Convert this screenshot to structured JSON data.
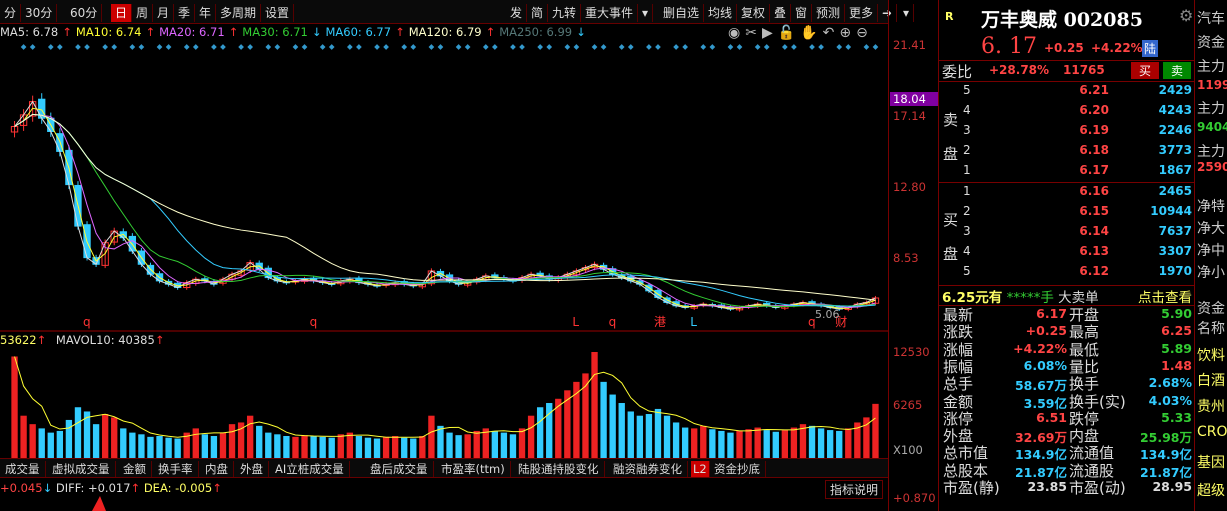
{
  "toolbar": {
    "left": [
      "分",
      "30分",
      "60分",
      "日",
      "周",
      "月",
      "季",
      "年",
      "多周期",
      "设置"
    ],
    "active": "日",
    "right": [
      "发",
      "简",
      "九转",
      "重大事件",
      "▾",
      "删自选",
      "均线",
      "复权",
      "叠",
      "窗",
      "预测",
      "更多",
      "➜",
      "▾"
    ]
  },
  "ma_legend": [
    {
      "label": "MA5: 6.78",
      "color": "#ddd",
      "dir": "up"
    },
    {
      "label": "MA10: 6.74",
      "color": "#ff3",
      "dir": "up"
    },
    {
      "label": "MA20: 6.71",
      "color": "#d6f",
      "dir": "up"
    },
    {
      "label": "MA30: 6.71",
      "color": "#3c3",
      "dir": "down"
    },
    {
      "label": "MA60: 6.77",
      "color": "#3cf",
      "dir": "up"
    },
    {
      "label": "MA120: 6.79",
      "color": "#ffc",
      "dir": "up"
    },
    {
      "label": "MA250: 6.99",
      "color": "#577",
      "dir": "down"
    }
  ],
  "chart_tools": [
    "eye-icon",
    "scissors-icon",
    "play-icon",
    "lock-icon",
    "hand-icon",
    "undo-icon",
    "zoom-in-icon",
    "zoom-out-icon"
  ],
  "price_axis": {
    "labels": [
      "21.41",
      "17.14",
      "12.80",
      "8.53"
    ],
    "highlight": "18.04"
  },
  "volume_axis": {
    "labels": [
      "12530",
      "6265",
      "X100"
    ]
  },
  "macd_axis": {
    "label": "+0.870"
  },
  "chart_data": {
    "type": "candlestick",
    "close": [
      16.5,
      17.2,
      18.0,
      17.0,
      16.2,
      15.0,
      13.0,
      10.5,
      8.6,
      8.2,
      9.5,
      10.2,
      9.8,
      9.0,
      8.2,
      7.6,
      7.2,
      7.0,
      6.8,
      7.1,
      7.3,
      7.2,
      7.0,
      7.3,
      7.6,
      7.8,
      8.3,
      7.9,
      7.4,
      7.2,
      7.1,
      7.2,
      7.3,
      7.2,
      7.1,
      7.0,
      7.2,
      7.3,
      7.1,
      7.0,
      6.9,
      7.0,
      7.1,
      7.0,
      6.9,
      7.0,
      7.8,
      7.5,
      7.2,
      7.0,
      7.1,
      7.3,
      7.5,
      7.4,
      7.3,
      7.2,
      7.4,
      7.6,
      7.5,
      7.3,
      7.4,
      7.6,
      7.8,
      8.0,
      8.2,
      7.9,
      7.6,
      7.4,
      7.2,
      7.0,
      6.6,
      6.2,
      5.9,
      5.7,
      5.6,
      5.7,
      5.8,
      5.7,
      5.6,
      5.5,
      5.6,
      5.7,
      5.8,
      5.7,
      5.6,
      5.7,
      5.8,
      5.9,
      5.8,
      5.7,
      5.6,
      5.5,
      5.6,
      5.8,
      5.9,
      6.17
    ],
    "volume": [
      12000,
      5000,
      4000,
      3500,
      3000,
      3200,
      4500,
      6000,
      5500,
      4000,
      5200,
      4800,
      3500,
      3000,
      2800,
      2500,
      2600,
      2400,
      2300,
      3000,
      3500,
      2800,
      2600,
      3000,
      4000,
      4200,
      5000,
      3800,
      3000,
      2800,
      2600,
      2500,
      2700,
      2600,
      2500,
      2400,
      2800,
      3000,
      2600,
      2400,
      2300,
      2500,
      2600,
      2400,
      2300,
      2600,
      5000,
      3800,
      3000,
      2700,
      2800,
      3200,
      3500,
      3200,
      3000,
      2800,
      3500,
      5000,
      6000,
      6500,
      7000,
      8000,
      9000,
      10000,
      12530,
      9000,
      7500,
      6500,
      5500,
      5000,
      5200,
      5800,
      5000,
      4200,
      3600,
      3500,
      3800,
      3400,
      3200,
      3000,
      3200,
      3400,
      3600,
      3300,
      3100,
      3300,
      3600,
      4000,
      3800,
      3500,
      3300,
      3200,
      3500,
      4200,
      4800,
      6400
    ],
    "markers": [
      {
        "text": "q",
        "idx": 8
      },
      {
        "text": "q",
        "idx": 33
      },
      {
        "text": "L",
        "idx": 62
      },
      {
        "text": "q",
        "idx": 66
      },
      {
        "text": "港",
        "idx": 71
      },
      {
        "text": "L",
        "idx": 75
      },
      {
        "text": "q",
        "idx": 88
      },
      {
        "text": "财",
        "idx": 91
      }
    ],
    "low_label": "5.06",
    "price_range": [
      4.5,
      21.41
    ],
    "volume_max": 12530
  },
  "vol_legend": {
    "vol": "53622",
    "mavol": "MAVOL10: 40385"
  },
  "bottom_tabs": [
    "成交量",
    "虚拟成交量",
    "金额",
    "换手率",
    "内盘",
    "外盘",
    "AI立桩成交量",
    "盘后成交量",
    "市盈率(ttm)",
    "陆股通持股变化",
    "融资融券变化",
    "资金抄底"
  ],
  "l2_badge": "L2",
  "macd": {
    "macd": "+0.045",
    "diff": "DIFF: +0.017",
    "dea": "DEA: -0.005",
    "explain": "指标说明"
  },
  "quote": {
    "r": "R",
    "name": "万丰奥威 002085",
    "price": "6. 17",
    "chg": "+0.25",
    "pct": "+4.22%",
    "lu": "陆",
    "weibi_label": "委比",
    "weibi": "+28.78%",
    "weicha": "11765",
    "buy": "买",
    "sell": "卖",
    "sell_label": "卖盘",
    "buy_label": "买盘",
    "asks": [
      [
        "5",
        "6.21",
        "2429"
      ],
      [
        "4",
        "6.20",
        "4243"
      ],
      [
        "3",
        "6.19",
        "2246"
      ],
      [
        "2",
        "6.18",
        "3773"
      ],
      [
        "1",
        "6.17",
        "1867"
      ]
    ],
    "bids": [
      [
        "1",
        "6.16",
        "2465"
      ],
      [
        "2",
        "6.15",
        "10944"
      ],
      [
        "3",
        "6.14",
        "7637"
      ],
      [
        "4",
        "6.13",
        "3307"
      ],
      [
        "5",
        "6.12",
        "1970"
      ]
    ],
    "bigorder": {
      "price": "6.25元有",
      "hands": "*****手",
      "text": "大卖单",
      "link": "点击查看"
    },
    "stats": [
      [
        "最新",
        "6.17",
        "red",
        "开盘",
        "5.90",
        "grn"
      ],
      [
        "涨跌",
        "+0.25",
        "red",
        "最高",
        "6.25",
        "red"
      ],
      [
        "涨幅",
        "+4.22%",
        "red",
        "最低",
        "5.89",
        "grn"
      ],
      [
        "振幅",
        "6.08%",
        "cyan",
        "量比",
        "1.48",
        "red"
      ],
      [
        "总手",
        "58.67万",
        "cyan",
        "换手",
        "2.68%",
        "cyan"
      ],
      [
        "金额",
        "3.59亿",
        "cyan",
        "换手(实)",
        "4.03%",
        "cyan"
      ],
      [
        "涨停",
        "6.51",
        "red",
        "跌停",
        "5.33",
        "grn"
      ],
      [
        "外盘",
        "32.69万",
        "red",
        "内盘",
        "25.98万",
        "grn"
      ],
      [
        "总市值",
        "134.9亿",
        "cyan",
        "流通值",
        "134.9亿",
        "cyan"
      ],
      [
        "总股本",
        "21.87亿",
        "cyan",
        "流通股",
        "21.87亿",
        "cyan"
      ],
      [
        "市盈(静)",
        "23.85",
        "wht",
        "市盈(动)",
        "28.95",
        "wht"
      ]
    ]
  },
  "far": [
    {
      "t": "汽车",
      "c": "#ccc"
    },
    {
      "t": "资金",
      "c": "#ccc"
    },
    {
      "t": "主力",
      "c": "#ccc"
    },
    {
      "t": "1199",
      "c": "#f44"
    },
    {
      "t": "主力",
      "c": "#ccc"
    },
    {
      "t": "9404",
      "c": "#3c3"
    },
    {
      "t": "主力",
      "c": "#ccc"
    },
    {
      "t": "2590",
      "c": "#f44"
    },
    {
      "t": "净特",
      "c": "#ccc"
    },
    {
      "t": "净大",
      "c": "#ccc"
    },
    {
      "t": "净中",
      "c": "#ccc"
    },
    {
      "t": "净小",
      "c": "#ccc"
    },
    {
      "t": "资金",
      "c": "#ccc"
    },
    {
      "t": "名称",
      "c": "#ccc"
    },
    {
      "t": "饮料",
      "c": "#ff6"
    },
    {
      "t": "白酒",
      "c": "#ff6"
    },
    {
      "t": "贵州",
      "c": "#ff6"
    },
    {
      "t": "CRO",
      "c": "#ff6"
    },
    {
      "t": "基因",
      "c": "#ff6"
    },
    {
      "t": "超级",
      "c": "#ff6"
    }
  ]
}
